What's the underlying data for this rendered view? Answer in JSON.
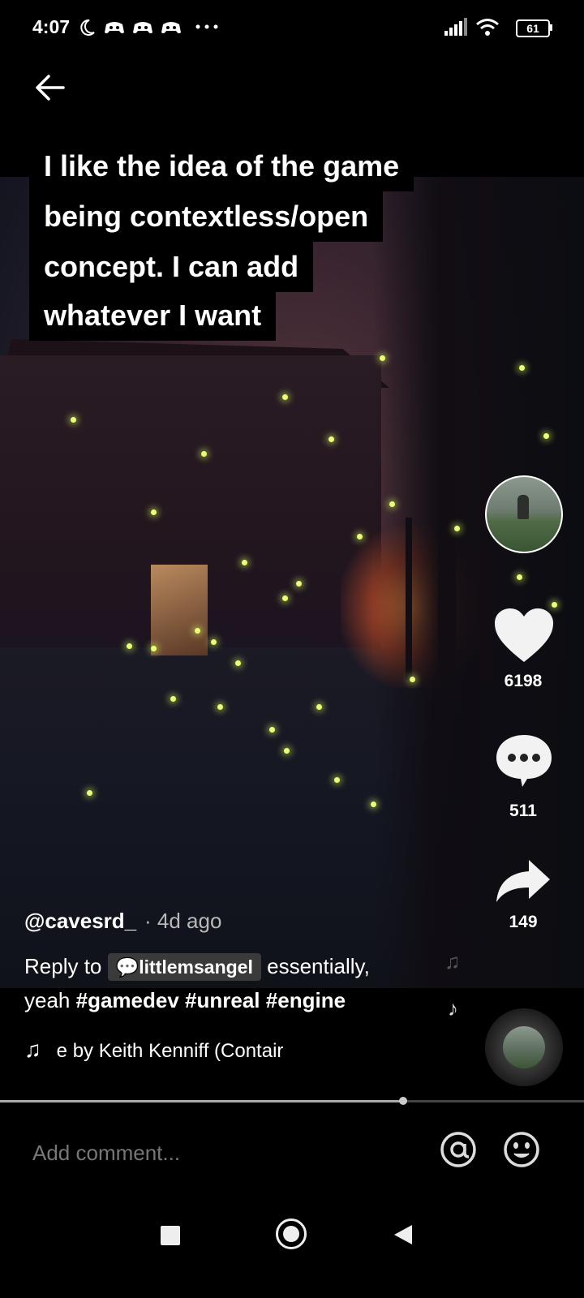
{
  "status_bar": {
    "time": "4:07",
    "battery": "61",
    "icons": [
      "moon-icon",
      "game-icon",
      "game-icon",
      "game-icon",
      "more-icon",
      "signal-icon",
      "wifi-icon",
      "battery-icon"
    ]
  },
  "caption": {
    "lines": [
      "I like the idea of the game",
      "being contextless/open",
      "concept. I can add",
      "whatever I want"
    ]
  },
  "rail": {
    "likes": "6198",
    "comments": "511",
    "shares": "149"
  },
  "post": {
    "username": "@cavesrd_",
    "age": "· 4d ago",
    "reply_to": "Reply to",
    "mention": "littlemsangel",
    "desc_after": "essentially,",
    "desc_line2": "yeah",
    "hashtags": [
      "#gamedev",
      "#unreal",
      "#engine"
    ],
    "song": "e by Keith Kenniff (Contair"
  },
  "playback": {
    "progress": 0.69
  },
  "comment": {
    "placeholder": "Add comment..."
  },
  "colors": {
    "firefly": "#e8ff77",
    "background": "#000000"
  }
}
